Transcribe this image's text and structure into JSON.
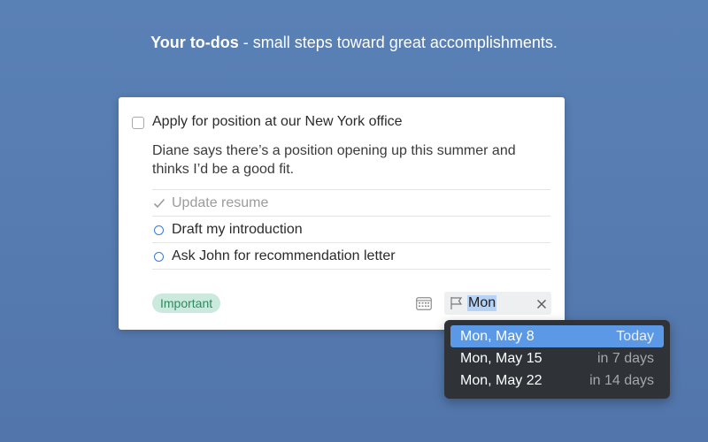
{
  "tagline": {
    "bold": "Your to-dos",
    "rest": " - small steps toward great accomplishments."
  },
  "todo": {
    "title": "Apply for position at our New York office",
    "notes": "Diane says there’s a position opening up this summer and thinks I’d be a good fit.",
    "checklist": [
      {
        "label": "Update resume",
        "done": true
      },
      {
        "label": "Draft my introduction",
        "done": false
      },
      {
        "label": "Ask John for recommendation letter",
        "done": false
      }
    ],
    "tag": "Important",
    "when_value": "Mon"
  },
  "date_suggestions": [
    {
      "date": "Mon, May 8",
      "relative": "Today",
      "selected": true
    },
    {
      "date": "Mon, May 15",
      "relative": "in 7 days",
      "selected": false
    },
    {
      "date": "Mon, May 22",
      "relative": "in 14 days",
      "selected": false
    }
  ],
  "colors": {
    "background": "#5a81b6",
    "accent": "#3a7bd5",
    "tag_bg": "#cbeadd",
    "tag_text": "#2e8a5f",
    "dropdown_bg": "#2f3338",
    "selection": "#5b99e6"
  },
  "icons": {
    "calendar": "calendar-icon",
    "flag": "flag-icon",
    "clear": "close-icon",
    "checked": "checkmark-icon",
    "open_item": "circle-icon"
  }
}
